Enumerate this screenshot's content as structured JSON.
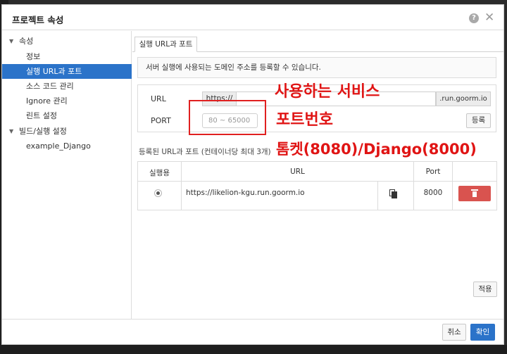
{
  "dialog": {
    "title": "프로젝트 속성"
  },
  "icons": {
    "help": "question-circle-icon",
    "close": "close-x-icon",
    "copy": "copy-icon",
    "delete": "trash-icon"
  },
  "sidebar": {
    "groups": [
      {
        "label": "속성",
        "expanded": true,
        "items": [
          "정보",
          "실행 URL과 포트",
          "소스 코드 관리",
          "Ignore 관리",
          "린트 설정"
        ],
        "selected": "실행 URL과 포트"
      },
      {
        "label": "빌드/실행 설정",
        "expanded": true,
        "items": [
          "example_Django"
        ]
      }
    ]
  },
  "tab": {
    "label": "실행 URL과 포트"
  },
  "info": {
    "text": "서버 실행에 사용되는 도메인 주소를 등록할 수 있습니다."
  },
  "form": {
    "url_label": "URL",
    "url_prefix": "https://",
    "url_value": "",
    "url_suffix": ".run.goorm.io",
    "port_label": "PORT",
    "port_placeholder": "80 ~ 65000",
    "register_label": "등록"
  },
  "registered": {
    "section_label": "등록된 URL과 포트 (컨테이너당 최대 3개)",
    "columns": [
      "실행용",
      "URL",
      "Port"
    ],
    "rows": [
      {
        "selected": true,
        "url": "https://likelion-kgu.run.goorm.io",
        "port": "8000"
      }
    ]
  },
  "buttons": {
    "apply": "적용",
    "cancel": "취소",
    "ok": "확인"
  },
  "annotations": {
    "service": "사용하는 서비스",
    "port_number": "포트번호",
    "ports": "톰켓(8080)/Django(8000)",
    "color": "#e01414"
  },
  "colors": {
    "accent": "#2b73c9",
    "danger": "#d9534f"
  }
}
